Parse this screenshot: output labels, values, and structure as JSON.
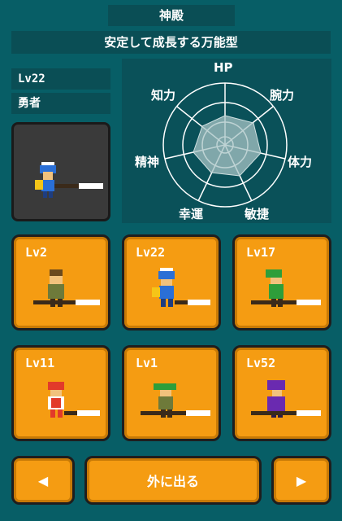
{
  "header": {
    "title": "神殿",
    "subtitle": "安定して成長する万能型"
  },
  "selected": {
    "level": "Lv22",
    "class": "勇者"
  },
  "stats": {
    "labels": {
      "hp": "HP",
      "str": "腕力",
      "vit": "体力",
      "agi": "敏捷",
      "luk": "幸運",
      "spi": "精神",
      "int": "知力"
    }
  },
  "party": [
    {
      "level": "Lv2",
      "hero": "brown-hair-swordsman-icon"
    },
    {
      "level": "Lv22",
      "hero": "blue-helmet-hero-icon"
    },
    {
      "level": "Lv17",
      "hero": "green-hood-archer-icon"
    },
    {
      "level": "Lv11",
      "hero": "red-hair-fighter-icon"
    },
    {
      "level": "Lv1",
      "hero": "green-hat-elf-icon"
    },
    {
      "level": "Lv52",
      "hero": "purple-hood-mage-icon"
    }
  ],
  "buttons": {
    "prev": "◀",
    "exit": "外に出る",
    "next": "▶"
  },
  "colors": {
    "background": "#075e66",
    "panel": "#0a4e55",
    "slot": "#f59c12",
    "radar_fill": "#8fb6b8"
  }
}
